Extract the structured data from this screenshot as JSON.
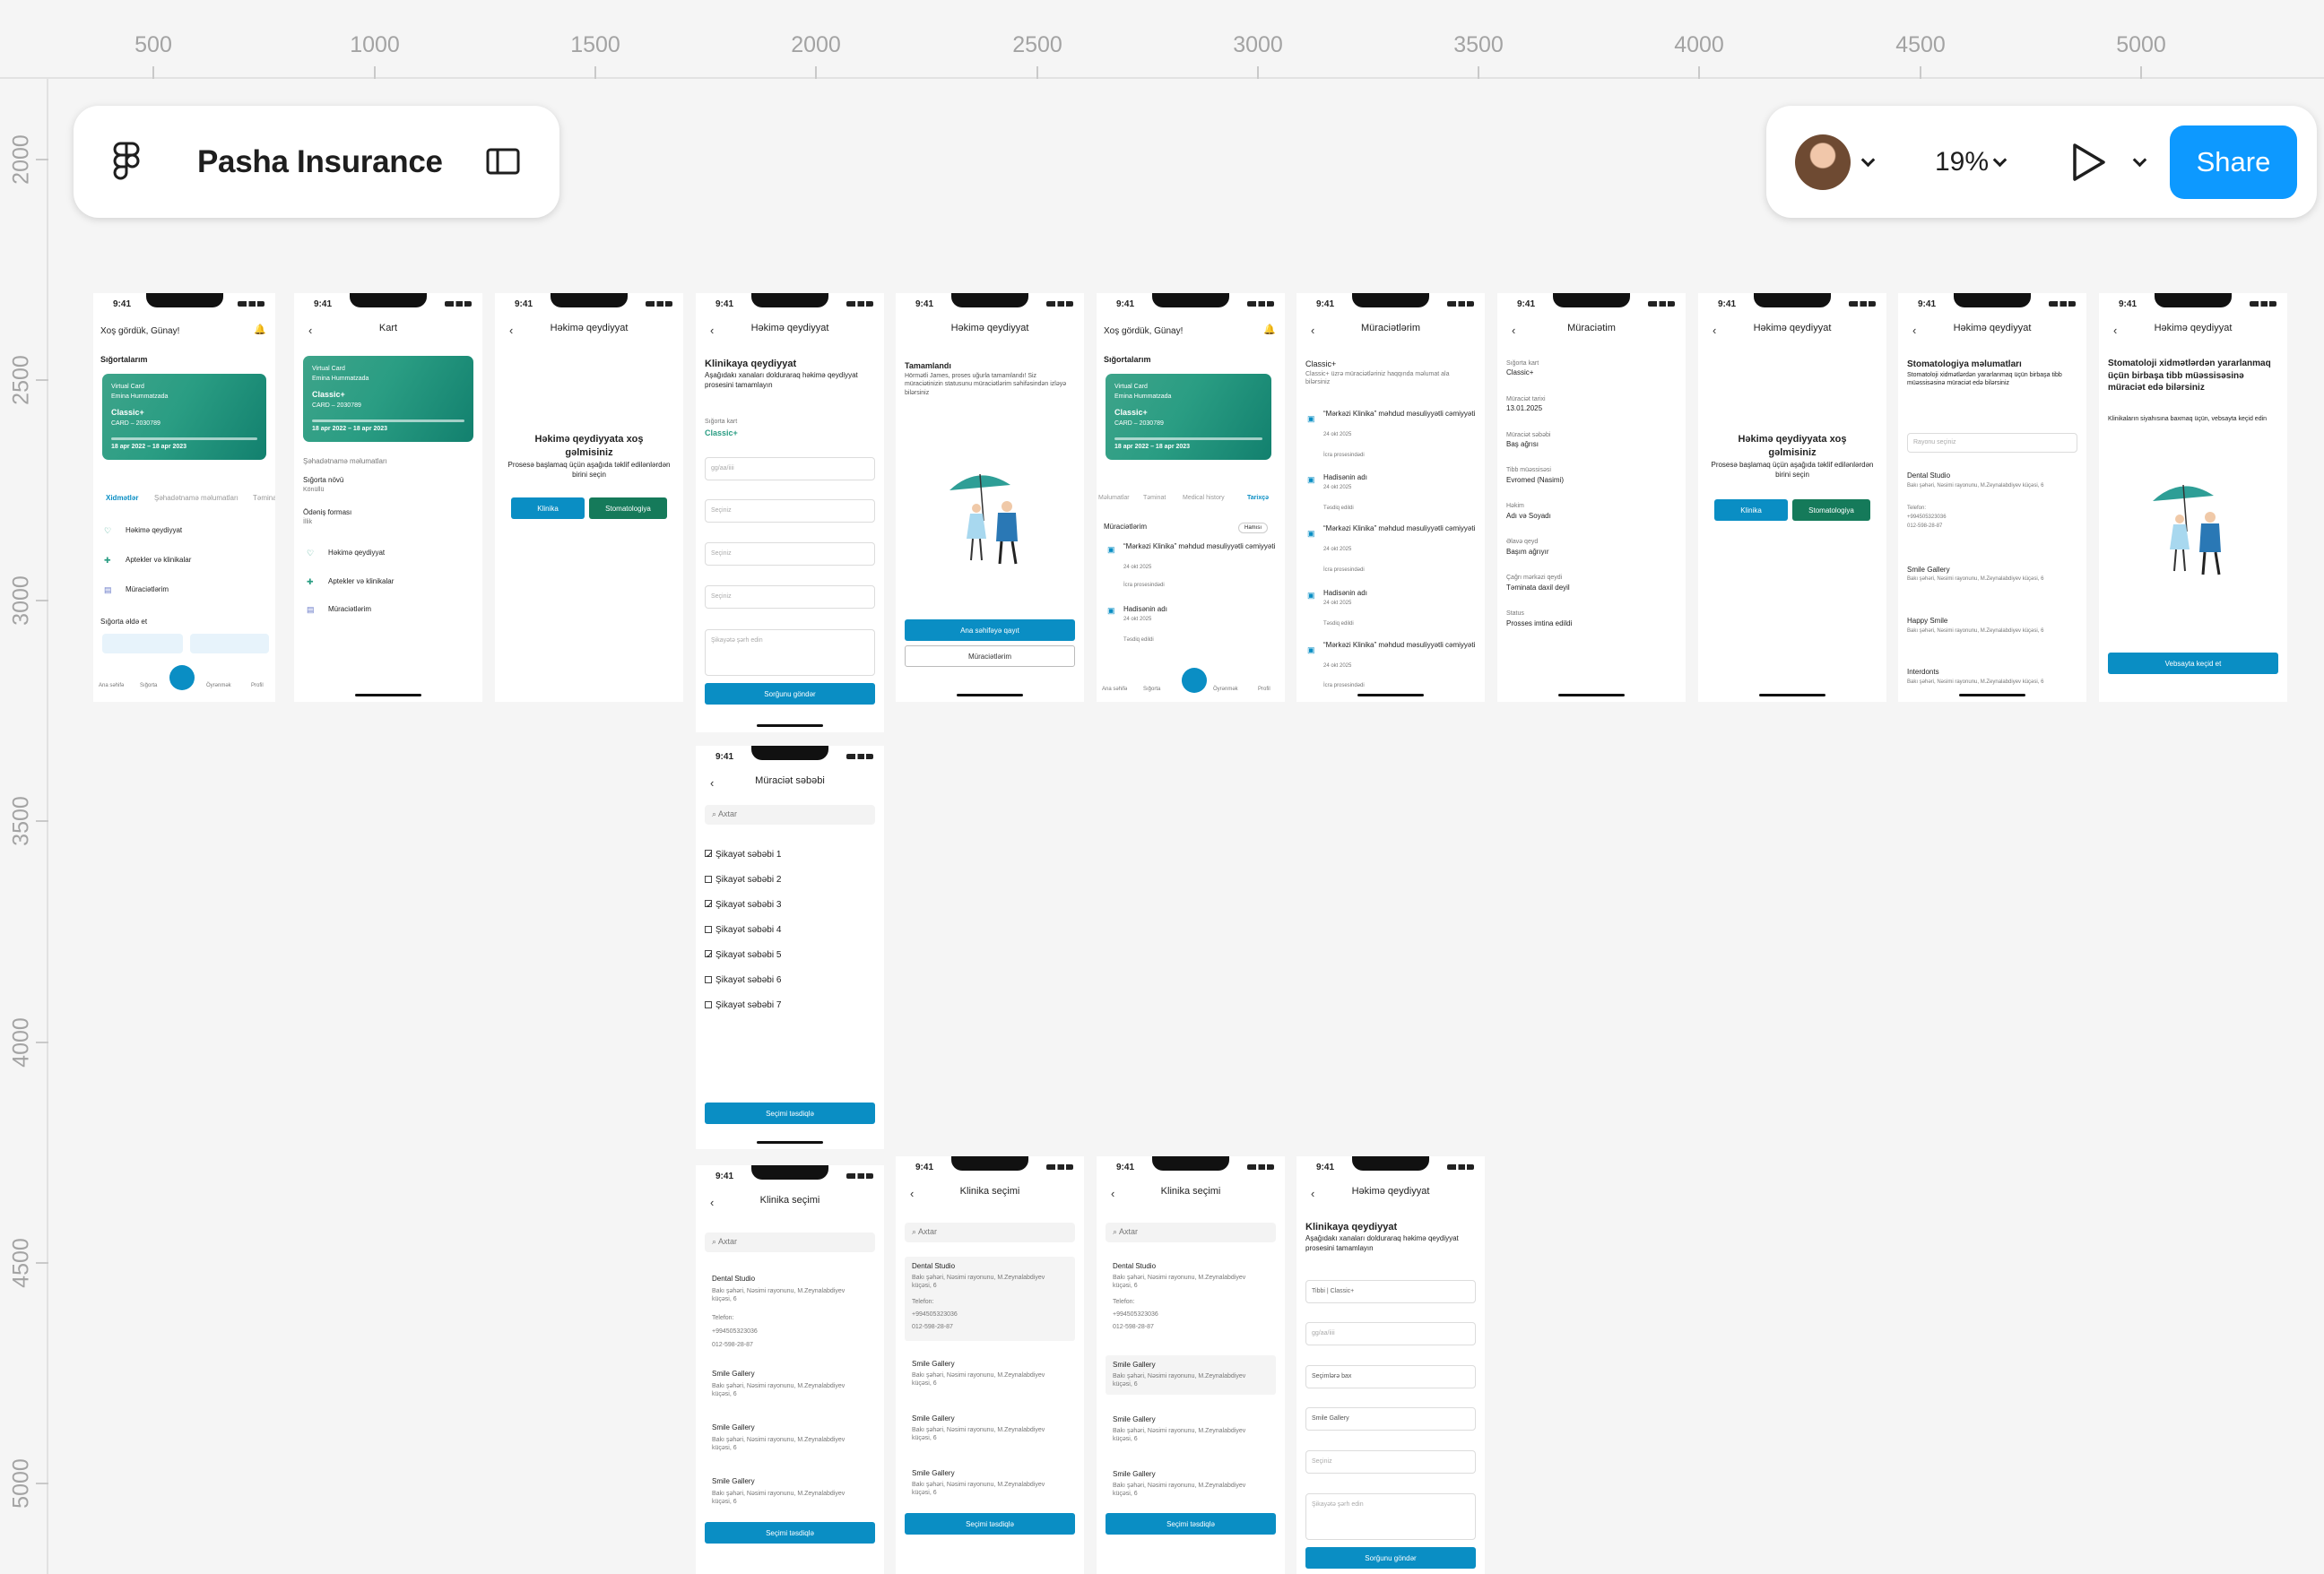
{
  "canvas": {
    "ruler_top_labels": [
      "500",
      "1000",
      "1500",
      "2000",
      "2500",
      "3000",
      "3500",
      "4000",
      "4500",
      "5000"
    ],
    "ruler_left_labels": [
      "2000",
      "2500",
      "3000",
      "3500",
      "4000",
      "4500",
      "5000"
    ]
  },
  "toolbar": {
    "file_title": "Pasha Insurance",
    "zoom": "19%",
    "share_label": "Share",
    "icons": [
      "figma-logo-icon",
      "sidebar-toggle-icon",
      "avatar",
      "chevron-down-icon",
      "play-icon"
    ],
    "accent": "#0d99ff"
  },
  "common": {
    "time": "9:41"
  },
  "f1": {
    "greeting": "Xoş gördük, Günay!",
    "section": "Sığortalarım",
    "card_l1": "Virtual Card",
    "card_l2": "Emina Hummatzada",
    "card_plan": "Classic+",
    "card_no": "CARD – 2030789",
    "card_dates": "18 apr 2022 – 18 apr 2023",
    "tab1": "Xidmətlər",
    "tab2": "Şəhadətnamə məlumatları",
    "tab3": "Təminat",
    "m1": "Həkimə qeydiyyat",
    "m2": "Aptekler və klinikalar",
    "m3": "Müraciətlərim",
    "buy": "Sığorta əldə et",
    "nav1": "Ana səhifə",
    "nav2": "Sığorta",
    "nav3": "Öyrənmək",
    "nav4": "Profil"
  },
  "f2": {
    "title": "Kart",
    "card_l1": "Virtual Card",
    "card_l2": "Emina Hummatzada",
    "card_plan": "Classic+",
    "card_no": "CARD – 2030789",
    "card_dates": "18 apr 2022 – 18 apr 2023",
    "sec": "Şəhadətnamə məlumatları",
    "k1": "Sığorta növü",
    "v1": "Könüllü",
    "k2": "Ödəniş forması",
    "v2": "İllik",
    "m1": "Həkimə qeydiyyat",
    "m2": "Aptekler və klinikalar",
    "m3": "Müraciətlərim"
  },
  "f3": {
    "title": "Həkimə qeydiyyat",
    "h": "Həkimə qeydiyyata xoş gəlmisiniz",
    "d": "Prosesə başlamaq üçün aşağıda təklif edilənlərdən birini seçin",
    "b1": "Klinika",
    "b2": "Stomatologiya"
  },
  "f4": {
    "title": "Həkimə qeydiyyat",
    "h": "Klinikaya qeydiyyat",
    "d": "Aşağıdakı xanaları dolduraraq həkimə qeydiyyat prosesini tamamlayın",
    "card_k": "Sığorta kart",
    "card_v": "Classic+",
    "fld1": "gg/aa/iiii",
    "fld2": "Seçiniz",
    "fld3": "Seçiniz",
    "fld4": "Seçiniz",
    "fld5": "Şikayətə şərh edin",
    "btn": "Sorğunu göndər"
  },
  "f5": {
    "title": "Həkimə qeydiyyat",
    "h": "Tamamlandı",
    "d": "Hörmətli James, proses uğurla tamamlandı! Siz müraciətinizin statusunu müraciətlərim səhifəsindən izləyə bilərsiniz",
    "b1": "Ana səhifəyə qayıt",
    "b2": "Müraciətlərim"
  },
  "f6": {
    "greeting": "Xoş gördük, Günay!",
    "section": "Sığortalarım",
    "card_l1": "Virtual Card",
    "card_l2": "Emina Hummatzada",
    "card_plan": "Classic+",
    "card_no": "CARD – 2030789",
    "card_dates": "18 apr 2022 – 18 apr 2023",
    "tab1": "Məlumatlar",
    "tab2": "Təminat",
    "tab3": "Medical history",
    "tab4": "Tarixçə",
    "list_h": "Müraciətlərim",
    "filter": "Hamısı",
    "a1": "“Mərkəzi Klinika” məhdud məsuliyyətli cəmiyyəti",
    "a1d": "24 okt 2025",
    "a1s": "İcra prosesindədi",
    "a2": "Hadisənin adı",
    "a2d": "24 okt 2025",
    "a2s": "Təsdiq edildi",
    "nav1": "Ana səhifə",
    "nav2": "Sığorta",
    "nav3": "Öyrənmək",
    "nav4": "Profil"
  },
  "f7": {
    "title": "Müraciətlərim",
    "h": "Classic+",
    "d": "Classic+ üzrə müraciətləriniz haqqında məlumat ala bilərsiniz",
    "i1": "“Mərkəzi Klinika” məhdud məsuliyyətli cəmiyyəti",
    "i1d": "24 okt 2025",
    "i1s": "İcra prosesindədi",
    "i2": "Hadisənin adı",
    "i2d": "24 okt 2025",
    "i2s": "Təsdiq edildi",
    "i3": "“Mərkəzi Klinika” məhdud məsuliyyətli cəmiyyəti",
    "i3d": "24 okt 2025",
    "i3s": "İcra prosesindədi",
    "i4": "Hadisənin adı",
    "i4d": "24 okt 2025",
    "i4s": "Təsdiq edildi",
    "i5": "“Mərkəzi Klinika” məhdud məsuliyyətli cəmiyyəti",
    "i5d": "24 okt 2025",
    "i5s": "İcra prosesindədi"
  },
  "f8": {
    "title": "Müraciətim",
    "k1": "Sığorta kart",
    "v1": "Classic+",
    "k2": "Müraciət tarixi",
    "v2": "13.01.2025",
    "k3": "Müraciət səbəbi",
    "v3": "Baş ağrısı",
    "k4": "Tibb müəssisəsi",
    "v4": "Evromed (Nasimi)",
    "k5": "Həkim",
    "v5": "Adı və Soyadı",
    "k6": "Əlavə qeyd",
    "v6": "Başım ağrıyır",
    "k7": "Çağrı mərkəzi qeydi",
    "v7": "Təminata daxil deyil",
    "k8": "Status",
    "v8": "Prosses imtina edildi"
  },
  "f9": {
    "title": "Həkimə qeydiyyat",
    "h": "Həkimə qeydiyyata xoş gəlmisiniz",
    "d": "Prosesə başlamaq üçün aşağıda təklif edilənlərdən birini seçin",
    "b1": "Klinika",
    "b2": "Stomatologiya"
  },
  "f10": {
    "title": "Həkimə qeydiyyat",
    "h": "Stomatologiya məlumatları",
    "d": "Stomatoloji xidmətlərdən yararlanmaq üçün birbaşa tibb müəssisəsinə müraciət edə bilərsiniz",
    "fld": "Rayonu seçiniz",
    "c1": "Dental Studio",
    "c1a": "Bakı şəhəri, Nəsimi rayonunu, M.Zeynalabdiyev küçəsi, 6",
    "c1t": "Telefon:",
    "c1p1": "+994505323036",
    "c1p2": "012-598-28-87",
    "c2": "Smile Gallery",
    "c2a": "Bakı şəhəri, Nəsimi rayonunu, M.Zeynalabdiyev küçəsi, 6",
    "c3": "Happy Smile",
    "c3a": "Bakı şəhəri, Nəsimi rayonunu, M.Zeynalabdiyev küçəsi, 6",
    "c4": "Interdonts",
    "c4a": "Bakı şəhəri, Nəsimi rayonunu, M.Zeynalabdiyev küçəsi, 6"
  },
  "f11": {
    "title": "Həkimə qeydiyyat",
    "h": "Stomatoloji xidmətlərdən yararlanmaq üçün birbaşa tibb müəssisəsinə müraciət edə bilərsiniz",
    "d": "Klinikaların siyahısına baxmaq üçün, vebsayta keçid edin",
    "btn": "Vebsayta keçid et"
  },
  "f12": {
    "title": "Müraciət səbəbi",
    "search": "Axtar",
    "c1": "Şikayət səbəbi 1",
    "c2": "Şikayət səbəbi 2",
    "c3": "Şikayət səbəbi 3",
    "c4": "Şikayət səbəbi 4",
    "c5": "Şikayət səbəbi 5",
    "c6": "Şikayət səbəbi 6",
    "c7": "Şikayət səbəbi 7",
    "btn": "Seçimi təsdiqlə"
  },
  "clinic": {
    "title": "Klinika seçimi",
    "search": "Axtar",
    "c1": "Dental Studio",
    "addr": "Bakı şəhəri, Nəsimi rayonunu, M.Zeynalabdiyev küçəsi, 6",
    "tel": "Telefon:",
    "p1": "+994505323036",
    "p2": "012-598-28-87",
    "c2": "Smile Gallery",
    "btn": "Seçimi təsdiqlə"
  },
  "f16": {
    "title": "Həkimə qeydiyyat",
    "h": "Klinikaya qeydiyyat",
    "d": "Aşağıdakı xanaları dolduraraq həkimə qeydiyyat prosesini tamamlayın",
    "fld1": "Tibbi | Classic+",
    "fld2": "gg/aa/iiii",
    "fld3": "Seçimlərə bax",
    "fld4": "Smile Gallery",
    "fld5": "Seçiniz",
    "fld6": "Şikayətə şərh edin",
    "btn": "Sorğunu göndər"
  }
}
